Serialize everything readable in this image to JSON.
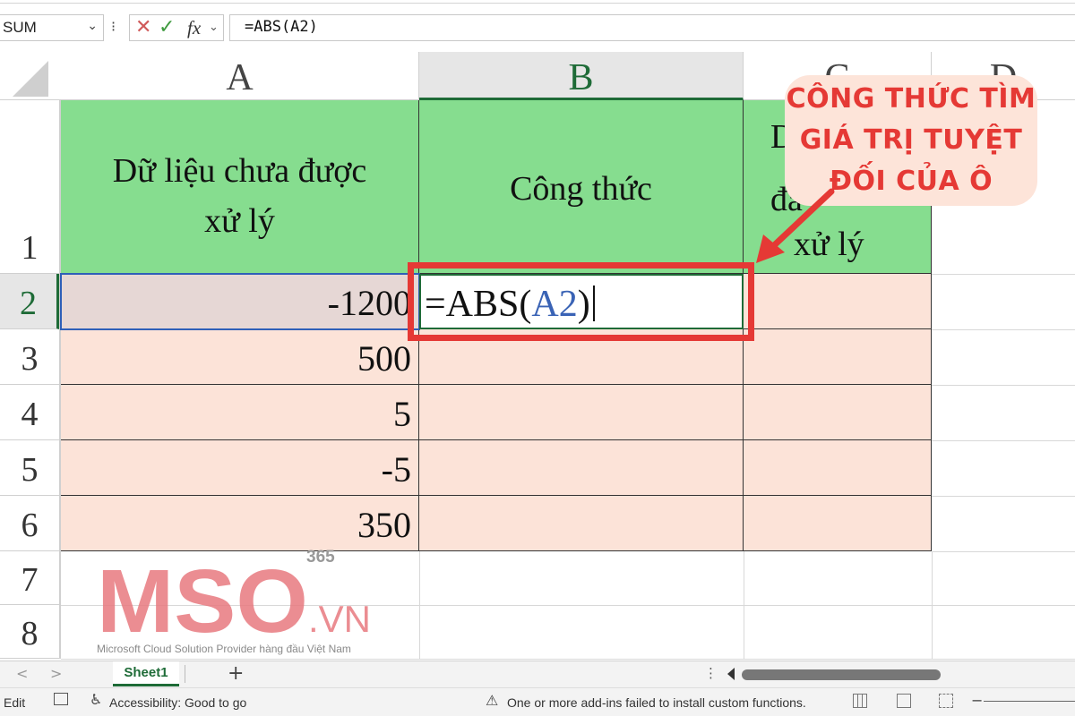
{
  "formula_bar": {
    "name_box": "SUM",
    "cancel_icon": "✕",
    "enter_icon": "✓",
    "fx_label": "fx",
    "formula": "=ABS(A2)"
  },
  "columns": [
    "A",
    "B",
    "C",
    "D"
  ],
  "rows": [
    "1",
    "2",
    "3",
    "4",
    "5",
    "6",
    "7",
    "8"
  ],
  "headers": {
    "a_line1": "Dữ liệu chưa được",
    "a_line2": "xử lý",
    "b": "Công thức",
    "c_line1": "D",
    "c_line2": "đã",
    "c_line3": "xử lý"
  },
  "data": {
    "a2": "-1200",
    "a3": "500",
    "a4": "5",
    "a5": "-5",
    "a6": "350"
  },
  "edit_cell": {
    "prefix": "=ABS(",
    "ref": "A2",
    "suffix": ")"
  },
  "callout": {
    "line1": "CÔNG THỨC TÌM",
    "line2": "GIÁ TRỊ TUYỆT",
    "line3": "ĐỐI CỦA Ô",
    "color": "#e53935"
  },
  "watermark": {
    "brand": "MSO",
    "suffix": ".VN",
    "superscript": "365",
    "tagline": "Microsoft Cloud Solution Provider hàng đầu Việt Nam"
  },
  "sheet_tabs": {
    "prev": "<",
    "next": ">",
    "active": "Sheet1",
    "add": "+"
  },
  "status_bar": {
    "mode": "Edit",
    "accessibility": "Accessibility: Good to go",
    "warning": "One or more add-ins failed to install custom functions."
  },
  "colors": {
    "header_green": "#86dd8f",
    "data_pink": "#fce3d8",
    "excel_green": "#1e6b37",
    "highlight_red": "#e53935"
  }
}
